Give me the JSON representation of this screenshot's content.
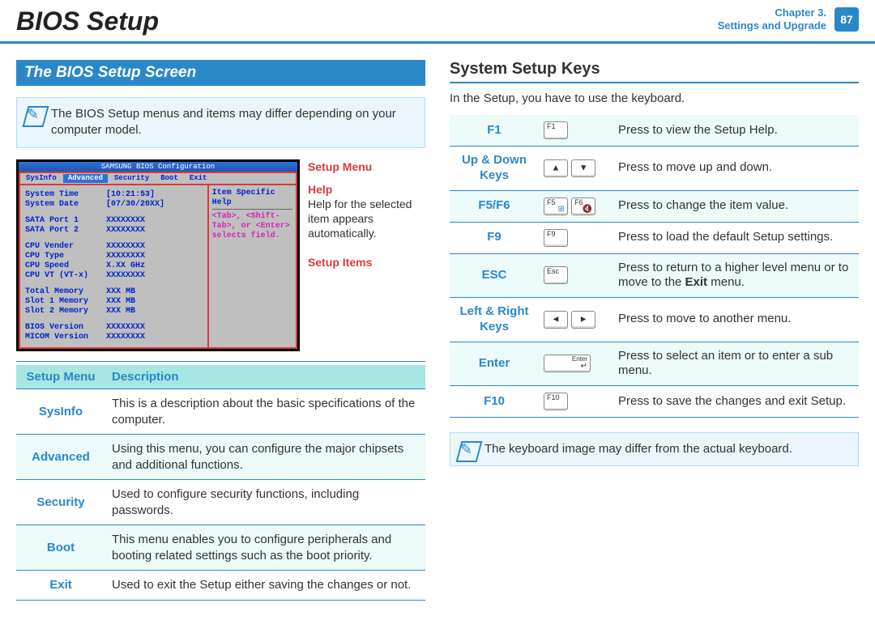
{
  "header": {
    "title": "BIOS Setup",
    "chapter_line1": "Chapter 3.",
    "chapter_line2": "Settings and Upgrade",
    "page": "87"
  },
  "left": {
    "section_title": "The BIOS Setup Screen",
    "note": "The BIOS Setup menus and items may differ depending on your computer model.",
    "screenshot": {
      "titlebar": "SAMSUNG BIOS Configuration",
      "tabs": [
        "SysInfo",
        "Advanced",
        "Security",
        "Boot",
        "Exit"
      ],
      "rows": [
        {
          "k": "System Time",
          "v": "[10:21:53]"
        },
        {
          "k": "System Date",
          "v": "[07/30/20XX]"
        },
        {
          "k": "",
          "v": ""
        },
        {
          "k": "SATA Port 1",
          "v": "XXXXXXXX"
        },
        {
          "k": "SATA Port 2",
          "v": "XXXXXXXX"
        },
        {
          "k": "",
          "v": ""
        },
        {
          "k": "CPU Vender",
          "v": "XXXXXXXX"
        },
        {
          "k": "CPU Type",
          "v": "XXXXXXXX"
        },
        {
          "k": "CPU Speed",
          "v": "X.XX GHz"
        },
        {
          "k": "CPU VT (VT-x)",
          "v": "XXXXXXXX"
        },
        {
          "k": "",
          "v": ""
        },
        {
          "k": "Total Memory",
          "v": "XXX MB"
        },
        {
          "k": "  Slot 1 Memory",
          "v": "XXX MB"
        },
        {
          "k": "  Slot 2 Memory",
          "v": "XXX MB"
        },
        {
          "k": "",
          "v": ""
        },
        {
          "k": "BIOS Version",
          "v": "XXXXXXXX"
        },
        {
          "k": "MICOM Version",
          "v": "XXXXXXXX"
        }
      ],
      "help_header": "Item Specific Help",
      "help_body": "<Tab>, <Shift-Tab>, or <Enter> selects field."
    },
    "callouts": {
      "menu": "Setup Menu",
      "help": "Help",
      "help_desc": "Help for the selected item appears automatically.",
      "items": "Setup Items"
    },
    "table": {
      "hdr_menu": "Setup Menu",
      "hdr_desc": "Description",
      "rows": [
        {
          "k": "SysInfo",
          "v": "This is a description about the basic specifications of the computer."
        },
        {
          "k": "Advanced",
          "v": "Using this menu, you can configure the major chipsets and additional functions."
        },
        {
          "k": "Security",
          "v": "Used to configure security functions, including passwords."
        },
        {
          "k": "Boot",
          "v": "This menu enables you to configure peripherals and booting related settings such as the boot priority."
        },
        {
          "k": "Exit",
          "v": "Used to exit the Setup either saving the changes or not."
        }
      ]
    }
  },
  "right": {
    "heading": "System Setup Keys",
    "intro": "In the Setup, you have to use the keyboard.",
    "rows": [
      {
        "name": "F1",
        "cap_labels": [
          "F1"
        ],
        "desc": "Press to view the Setup Help."
      },
      {
        "name": "Up & Down Keys",
        "cap_labels": [
          "▲",
          "▼"
        ],
        "desc": "Press to move up and down."
      },
      {
        "name": "F5/F6",
        "cap_labels": [
          "F5",
          "F6"
        ],
        "desc": "Press to change the item value."
      },
      {
        "name": "F9",
        "cap_labels": [
          "F9"
        ],
        "desc": "Press to load the default Setup settings."
      },
      {
        "name": "ESC",
        "cap_labels": [
          "Esc"
        ],
        "desc_html": "Press to return to a higher level menu or to move to the <b>Exit</b> menu."
      },
      {
        "name": "Left & Right Keys",
        "cap_labels": [
          "◄",
          "►"
        ],
        "desc": "Press to move to another menu."
      },
      {
        "name": "Enter",
        "cap_labels": [
          "Enter"
        ],
        "desc": "Press to select an item or to enter a sub menu."
      },
      {
        "name": "F10",
        "cap_labels": [
          "F10"
        ],
        "desc": "Press to save the changes and exit Setup."
      }
    ],
    "note": "The keyboard image may differ from the actual keyboard."
  }
}
